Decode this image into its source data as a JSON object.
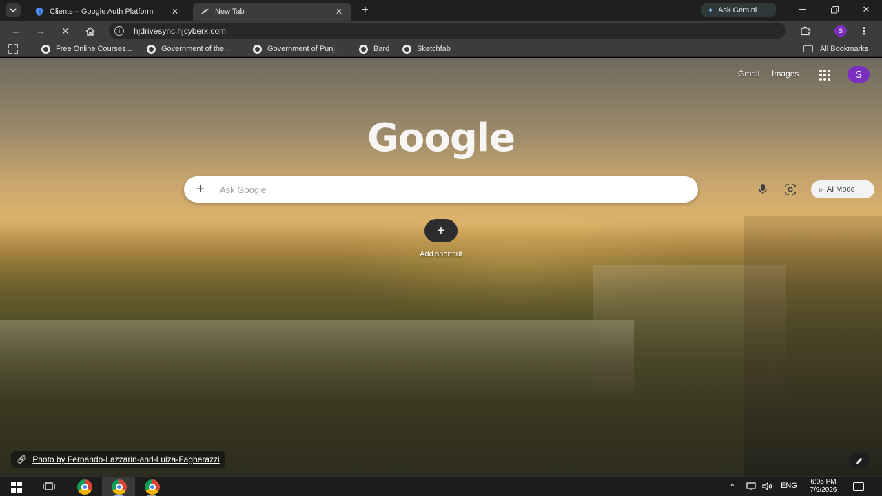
{
  "browser": {
    "tabs": [
      {
        "title": "Clients – Google Auth Platform",
        "icon": "shield-icon",
        "active": false
      },
      {
        "title": "New Tab",
        "icon": "bird-icon",
        "active": true
      }
    ],
    "ask_gemini_label": "Ask Gemini",
    "url": "hjdrivesync.hjcyberx.com",
    "profile_initial": "S",
    "bookmarks": [
      {
        "label": "Free Online Courses..."
      },
      {
        "label": "Government of the..."
      },
      {
        "label": "Government of Punj..."
      },
      {
        "label": "Bard"
      },
      {
        "label": "Sketchfab"
      }
    ],
    "all_bookmarks_label": "All Bookmarks"
  },
  "page": {
    "top_links": {
      "gmail": "Gmail",
      "images": "Images"
    },
    "avatar_initial": "S",
    "logo_text": "Google",
    "search": {
      "placeholder": "Ask Google",
      "ai_mode_label": "AI Mode"
    },
    "shortcut": {
      "add_label": "Add shortcut"
    },
    "photo_credit": "Photo by Fernando-Lazzarin-and-Luiza-Fagherazzi"
  },
  "taskbar": {
    "language": "ENG",
    "time": "6:05 PM",
    "date": "7/9/2026"
  },
  "colors": {
    "profile_purple": "#7b2fbf",
    "tab_strip": "#1f1f1f",
    "toolbar": "#3c3c3c"
  }
}
